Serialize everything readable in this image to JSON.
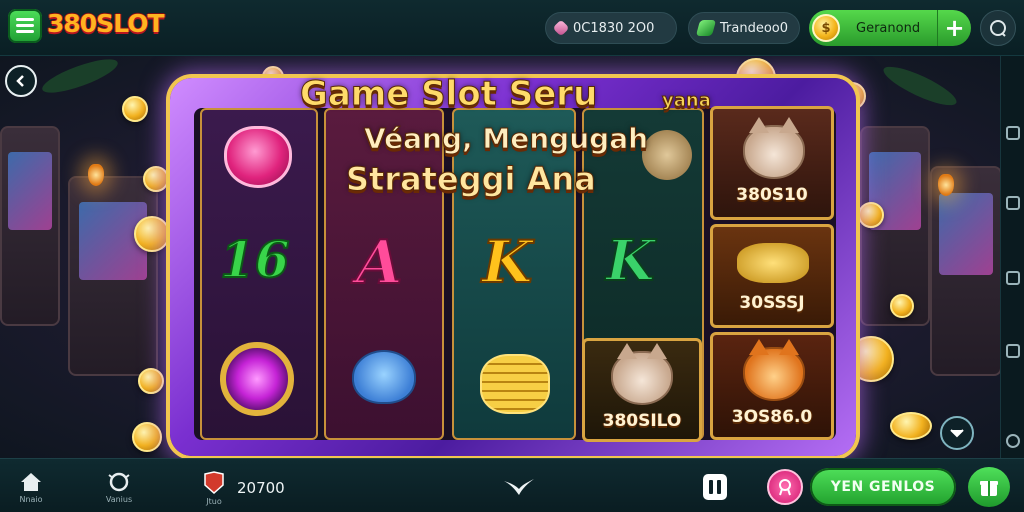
{
  "app": {
    "logo_text": "380SLOT"
  },
  "topbar": {
    "pill_1": {
      "icon": "pink-gem-icon",
      "text": "0C1830 2O0"
    },
    "pill_2": {
      "icon": "green-leaf-icon",
      "text": "Trandeoo0"
    },
    "balance": {
      "icon": "gold-coin-icon",
      "label": "Geranond",
      "add_icon": "plus-icon"
    },
    "profile_icon": "chat-refresh-icon"
  },
  "banner": {
    "line_1": "Game Slot Seru",
    "line_1_suffix": "yana",
    "line_2": "Véang, Mengugah",
    "line_3": "Strateggi Ana"
  },
  "reels": {
    "col1": {
      "top": "heart-gem",
      "mid": "16",
      "bottom": "purple-gem"
    },
    "col2": {
      "top": "",
      "mid": "A",
      "bottom": "blue-mouse"
    },
    "col3": {
      "top": "",
      "mid": "K",
      "bottom": "coin-stack"
    },
    "col4": {
      "top": "coin-bag",
      "mid": "K",
      "bottom": "380SILO"
    },
    "col5": {
      "top": "380S10",
      "mid": "30SSSJ",
      "bottom": "3OS86.0"
    }
  },
  "bottombar": {
    "home_label": "Nnaio",
    "vault_label": "Vanius",
    "bet_label": "Jtuo",
    "bet_value": "20700",
    "spin_label": "YEN GENLOS"
  },
  "colors": {
    "accent_green": "#3cc846",
    "frame_purple": "#8a3ad8",
    "gold": "#f2b21f",
    "logo_orange": "#ffb320"
  }
}
